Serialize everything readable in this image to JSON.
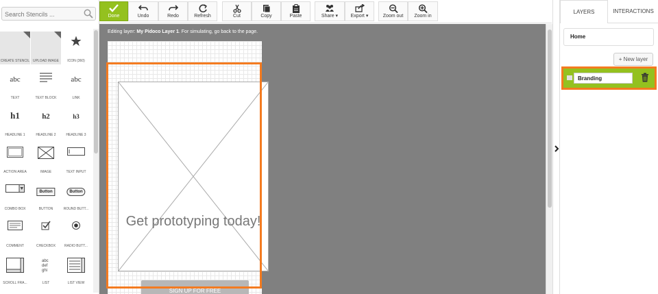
{
  "search": {
    "placeholder": "Search Stencils ..."
  },
  "stencils": [
    {
      "label": "CREATE STENCIL",
      "icon": "create-stencil-icon"
    },
    {
      "label": "UPLOAD IMAGE",
      "icon": "upload-image-icon"
    },
    {
      "label": "ICON (360)",
      "icon": "star-icon"
    },
    {
      "label": "TEXT",
      "icon": "text-icon",
      "glyph": "abc"
    },
    {
      "label": "TEXT BLOCK",
      "icon": "text-block-icon"
    },
    {
      "label": "LINK",
      "icon": "link-icon",
      "glyph": "abc"
    },
    {
      "label": "HEADLINE 1",
      "icon": "h1-icon",
      "glyph": "h1"
    },
    {
      "label": "HEADLINE 2",
      "icon": "h2-icon",
      "glyph": "h2"
    },
    {
      "label": "HEADLINE 3",
      "icon": "h3-icon",
      "glyph": "h3"
    },
    {
      "label": "ACTION AREA",
      "icon": "action-area-icon"
    },
    {
      "label": "IMAGE",
      "icon": "image-icon"
    },
    {
      "label": "TEXT INPUT",
      "icon": "text-input-icon"
    },
    {
      "label": "COMBO BOX",
      "icon": "combo-box-icon"
    },
    {
      "label": "BUTTON",
      "icon": "button-icon",
      "glyph": "Button"
    },
    {
      "label": "ROUND BUTT...",
      "icon": "round-button-icon",
      "glyph": "Button"
    },
    {
      "label": "COMMENT",
      "icon": "comment-icon"
    },
    {
      "label": "CHECKBOX",
      "icon": "checkbox-icon"
    },
    {
      "label": "RADIO BUTT...",
      "icon": "radio-button-icon"
    },
    {
      "label": "SCROLL FRA...",
      "icon": "scroll-frame-icon"
    },
    {
      "label": "LIST",
      "icon": "list-icon"
    },
    {
      "label": "LIST VIEW",
      "icon": "list-view-icon"
    }
  ],
  "toolbar": {
    "done": "Done",
    "undo": "Undo",
    "redo": "Redo",
    "refresh": "Refresh",
    "cut": "Cut",
    "copy": "Copy",
    "paste": "Paste",
    "share": "Share ▾",
    "export": "Export ▾",
    "zoom_out": "Zoom out",
    "zoom_in": "Zoom in"
  },
  "canvas": {
    "note_prefix": "Editing layer: ",
    "layer_name": "My Pidoco Layer 1",
    "note_suffix": ". For simulating, go back to the page.",
    "promo": "Get prototyping today!",
    "signup": "SIGN UP FOR FREE"
  },
  "right_panel": {
    "tab_layers": "LAYERS",
    "tab_interactions": "INTERACTIONS",
    "home": "Home",
    "new_layer": "+ New layer",
    "layer_value": "Branding"
  },
  "colors": {
    "accent": "#94c11f",
    "highlight": "#f47b20",
    "canvas": "#808080"
  }
}
